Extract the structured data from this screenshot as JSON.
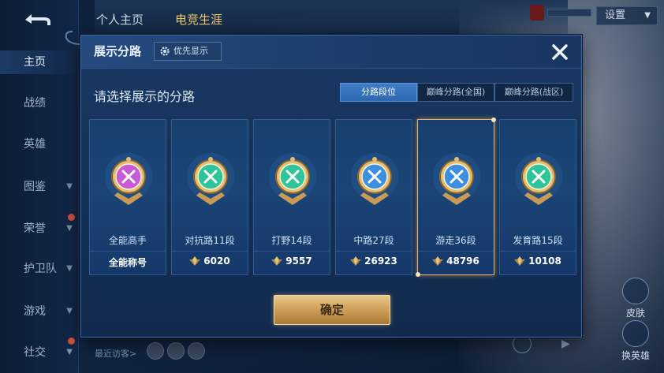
{
  "background": {
    "tabs": [
      "个人主页",
      "电竞生涯"
    ],
    "settings_label": "设置",
    "visitors_label": "最近访客>",
    "right_widgets": [
      "皮肤",
      "换英雄"
    ]
  },
  "leftnav": {
    "items": [
      {
        "label": "主页",
        "active": true,
        "chevron": false,
        "dot": false
      },
      {
        "label": "战绩",
        "active": false,
        "chevron": false,
        "dot": false
      },
      {
        "label": "英雄",
        "active": false,
        "chevron": false,
        "dot": false
      },
      {
        "label": "图鉴",
        "active": false,
        "chevron": true,
        "dot": false
      },
      {
        "label": "荣誉",
        "active": false,
        "chevron": true,
        "dot": true
      },
      {
        "label": "护卫队",
        "active": false,
        "chevron": true,
        "dot": false
      },
      {
        "label": "游戏",
        "active": false,
        "chevron": true,
        "dot": false
      },
      {
        "label": "社交",
        "active": false,
        "chevron": true,
        "dot": true
      }
    ]
  },
  "modal": {
    "title": "展示分路",
    "pref_label": "优先显示",
    "subtitle": "请选择展示的分路",
    "segments": [
      {
        "label": "分路段位",
        "active": true
      },
      {
        "label": "巅峰分路(全国)",
        "active": false
      },
      {
        "label": "巅峰分路(战区)",
        "active": false
      }
    ],
    "cards": [
      {
        "rank": "全能高手",
        "score": "全能称号",
        "icon": "allround-badge-icon",
        "color": "#c85ad8",
        "selected": false,
        "show_diamond": false
      },
      {
        "rank": "对抗路11段",
        "score": "6020",
        "icon": "clash-lane-badge-icon",
        "color": "#2fc49a",
        "selected": false,
        "show_diamond": true
      },
      {
        "rank": "打野14段",
        "score": "9557",
        "icon": "jungle-badge-icon",
        "color": "#2fc49a",
        "selected": false,
        "show_diamond": true
      },
      {
        "rank": "中路27段",
        "score": "26923",
        "icon": "mid-lane-badge-icon",
        "color": "#3c8fe0",
        "selected": false,
        "show_diamond": true
      },
      {
        "rank": "游走36段",
        "score": "48796",
        "icon": "roam-badge-icon",
        "color": "#3c8fe0",
        "selected": true,
        "show_diamond": true
      },
      {
        "rank": "发育路15段",
        "score": "10108",
        "icon": "farm-lane-badge-icon",
        "color": "#2fc49a",
        "selected": false,
        "show_diamond": true
      }
    ],
    "confirm_label": "确定"
  },
  "colors": {
    "accent_blue": "#2d67b0",
    "gold": "#c99a52",
    "selected_border": "#e9b26a"
  }
}
